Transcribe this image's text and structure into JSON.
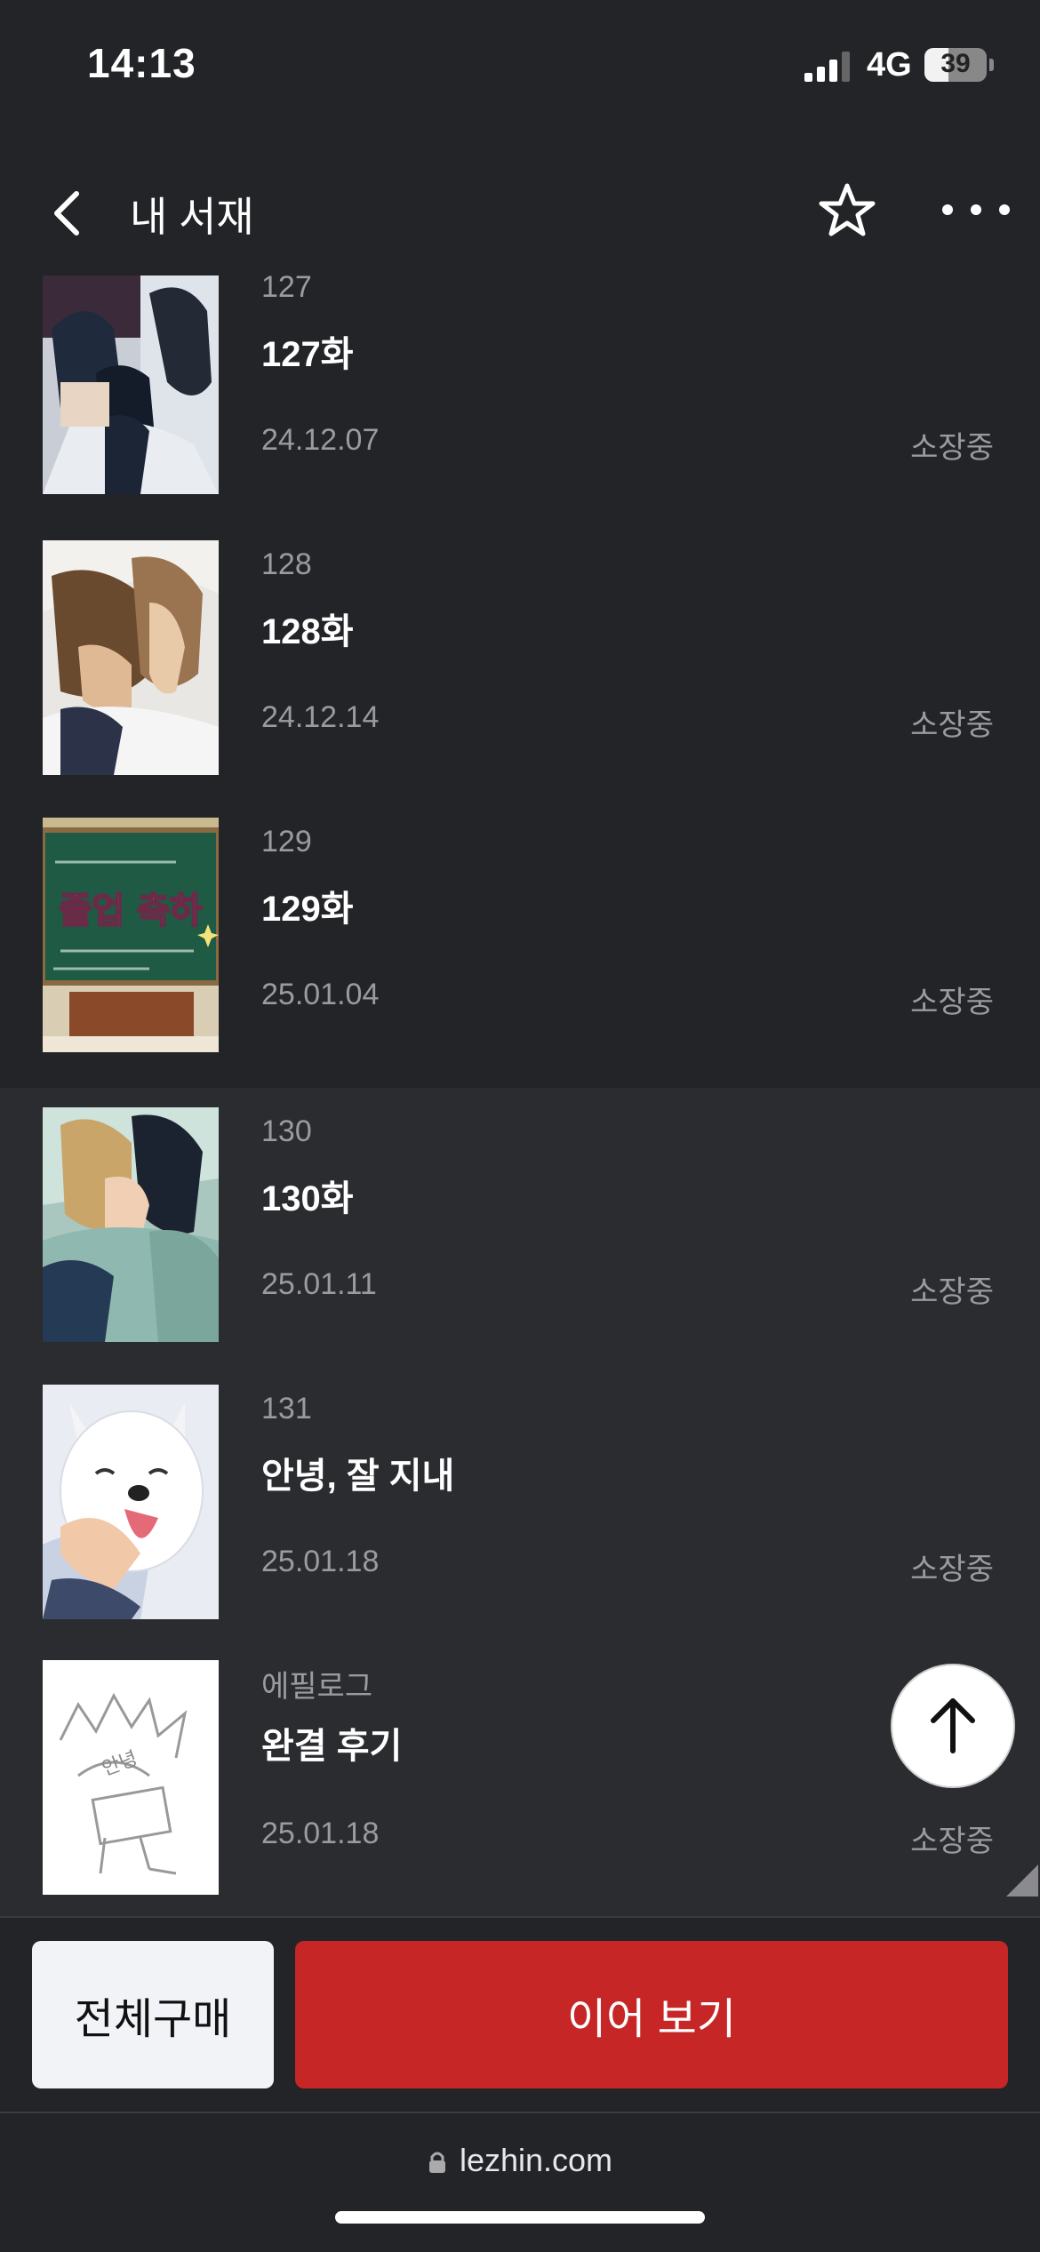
{
  "status_bar": {
    "time": "14:13",
    "network": "4G",
    "battery": "39"
  },
  "header": {
    "title": "내 서재",
    "back_icon": "chevron-left-icon",
    "star_icon": "star-outline-icon",
    "more_icon": "more-horizontal-icon"
  },
  "episodes": [
    {
      "number": "127",
      "title": "127화",
      "date": "24.12.07",
      "status": "소장중"
    },
    {
      "number": "128",
      "title": "128화",
      "date": "24.12.14",
      "status": "소장중"
    },
    {
      "number": "129",
      "title": "129화",
      "date": "25.01.04",
      "status": "소장중",
      "thumb_text": "졸업 축하"
    },
    {
      "number": "130",
      "title": "130화",
      "date": "25.01.11",
      "status": "소장중"
    },
    {
      "number": "131",
      "title": "안녕, 잘 지내",
      "date": "25.01.18",
      "status": "소장중"
    },
    {
      "number": "에필로그",
      "title": "완결 후기",
      "date": "25.01.18",
      "status": "소장중",
      "thumb_text": "안녕"
    }
  ],
  "bottom": {
    "buy_all": "전체구매",
    "continue": "이어 보기"
  },
  "browser": {
    "url": "lezhin.com"
  },
  "colors": {
    "background": "#232427",
    "highlight_row": "#2b2c30",
    "accent_red": "#c62626"
  }
}
